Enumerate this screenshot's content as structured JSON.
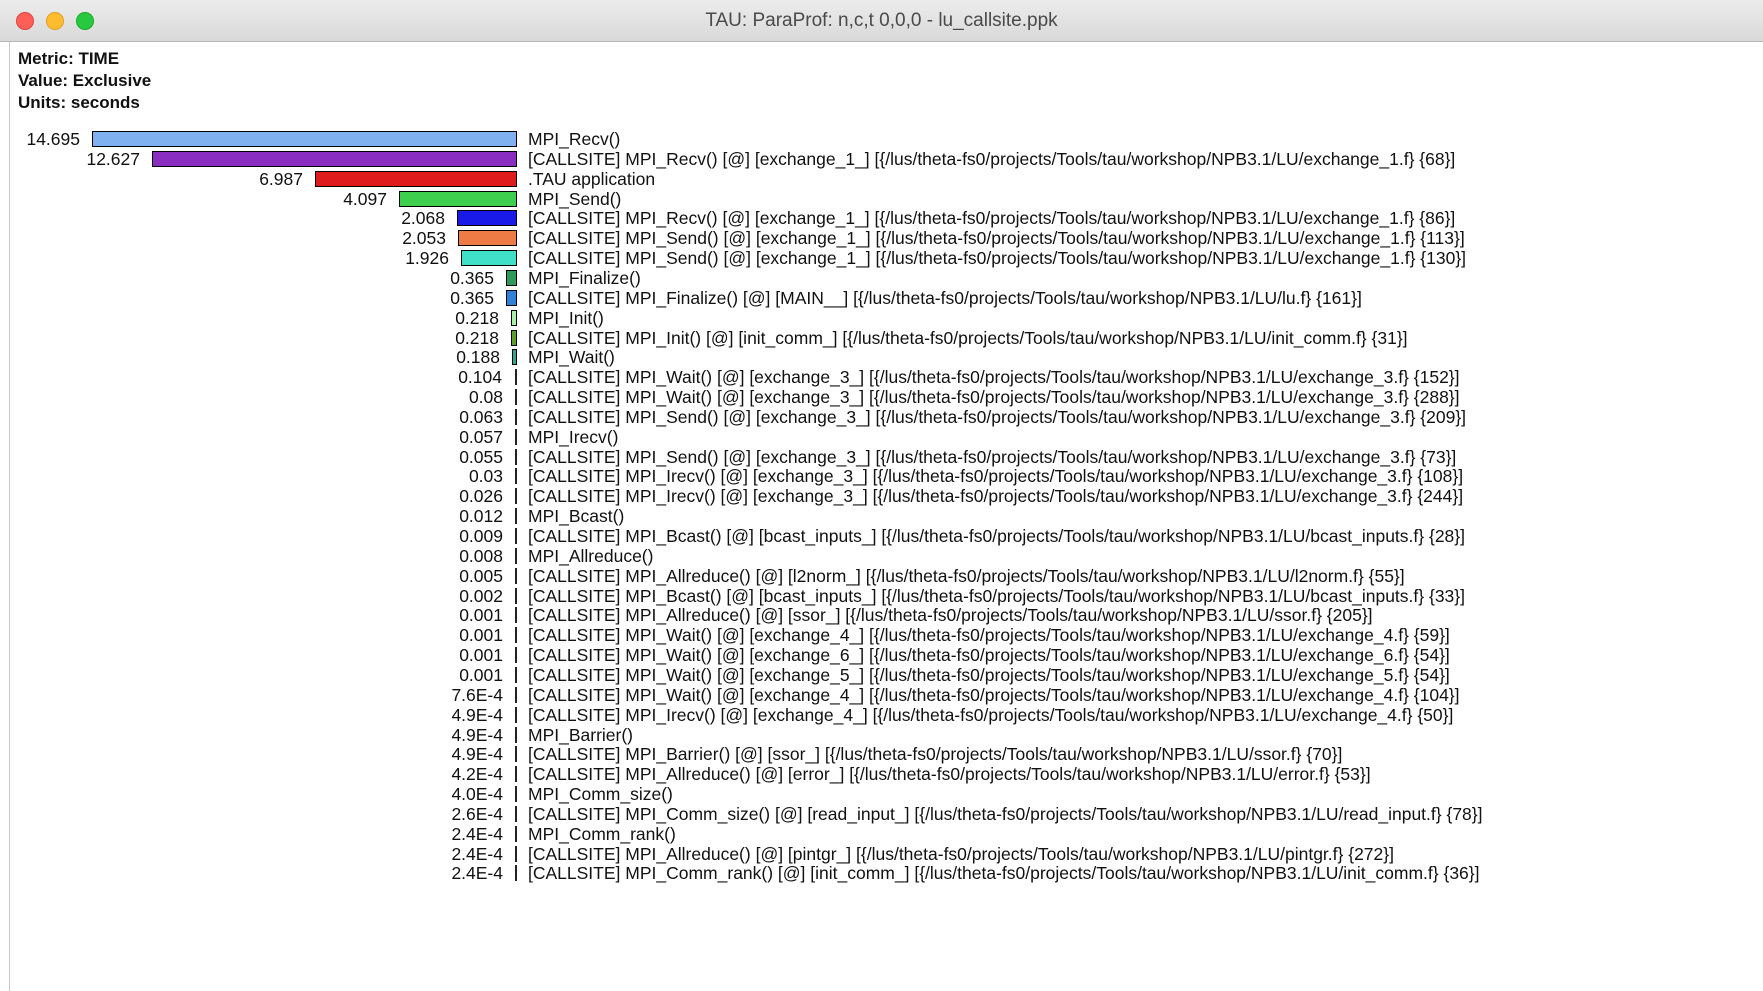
{
  "window": {
    "title": "TAU: ParaProf: n,c,t 0,0,0 - lu_callsite.ppk"
  },
  "meta": {
    "metric": "Metric: TIME",
    "value": "Value: Exclusive",
    "units": "Units: seconds"
  },
  "max_value": 14.695,
  "rows": [
    {
      "value": 14.695,
      "value_text": "14.695",
      "label": "MPI_Recv()",
      "color": "#7fb0f0"
    },
    {
      "value": 12.627,
      "value_text": "12.627",
      "label": "[CALLSITE] MPI_Recv() [@] [exchange_1_] [{/lus/theta-fs0/projects/Tools/tau/workshop/NPB3.1/LU/exchange_1.f} {68}]",
      "color": "#8a2ec2"
    },
    {
      "value": 6.987,
      "value_text": "6.987",
      "label": ".TAU application",
      "color": "#e01b1b"
    },
    {
      "value": 4.097,
      "value_text": "4.097",
      "label": "MPI_Send()",
      "color": "#3fcf4f"
    },
    {
      "value": 2.068,
      "value_text": "2.068",
      "label": "[CALLSITE] MPI_Recv() [@] [exchange_1_] [{/lus/theta-fs0/projects/Tools/tau/workshop/NPB3.1/LU/exchange_1.f} {86}]",
      "color": "#1a1ae8"
    },
    {
      "value": 2.053,
      "value_text": "2.053",
      "label": "[CALLSITE] MPI_Send() [@] [exchange_1_] [{/lus/theta-fs0/projects/Tools/tau/workshop/NPB3.1/LU/exchange_1.f} {113}]",
      "color": "#ee7a45"
    },
    {
      "value": 1.926,
      "value_text": "1.926",
      "label": "[CALLSITE] MPI_Send() [@] [exchange_1_] [{/lus/theta-fs0/projects/Tools/tau/workshop/NPB3.1/LU/exchange_1.f} {130}]",
      "color": "#40e0c8"
    },
    {
      "value": 0.365,
      "value_text": "0.365",
      "label": "MPI_Finalize()",
      "color": "#2e9a5a"
    },
    {
      "value": 0.365,
      "value_text": "0.365",
      "label": "[CALLSITE] MPI_Finalize() [@] [MAIN__] [{/lus/theta-fs0/projects/Tools/tau/workshop/NPB3.1/LU/lu.f} {161}]",
      "color": "#2f82d8"
    },
    {
      "value": 0.218,
      "value_text": "0.218",
      "label": "MPI_Init()",
      "color": "#a8f0a8"
    },
    {
      "value": 0.218,
      "value_text": "0.218",
      "label": "[CALLSITE] MPI_Init() [@] [init_comm_] [{/lus/theta-fs0/projects/Tools/tau/workshop/NPB3.1/LU/init_comm.f} {31}]",
      "color": "#5aa02a"
    },
    {
      "value": 0.188,
      "value_text": "0.188",
      "label": "MPI_Wait()",
      "color": "#2aa890"
    },
    {
      "value": 0.104,
      "value_text": "0.104",
      "label": "[CALLSITE] MPI_Wait() [@] [exchange_3_] [{/lus/theta-fs0/projects/Tools/tau/workshop/NPB3.1/LU/exchange_3.f} {152}]",
      "color": "#9ac040"
    },
    {
      "value": 0.08,
      "value_text": "0.08",
      "label": "[CALLSITE] MPI_Wait() [@] [exchange_3_] [{/lus/theta-fs0/projects/Tools/tau/workshop/NPB3.1/LU/exchange_3.f} {288}]",
      "color": "#1a3a8a"
    },
    {
      "value": 0.063,
      "value_text": "0.063",
      "label": "[CALLSITE] MPI_Send() [@] [exchange_3_] [{/lus/theta-fs0/projects/Tools/tau/workshop/NPB3.1/LU/exchange_3.f} {209}]",
      "color": "#4a4a4a"
    },
    {
      "value": 0.057,
      "value_text": "0.057",
      "label": "MPI_Irecv()",
      "color": "#3a3a3a"
    },
    {
      "value": 0.055,
      "value_text": "0.055",
      "label": "[CALLSITE] MPI_Send() [@] [exchange_3_] [{/lus/theta-fs0/projects/Tools/tau/workshop/NPB3.1/LU/exchange_3.f} {73}]",
      "color": "#1a2a6a"
    },
    {
      "value": 0.03,
      "value_text": "0.03",
      "label": "[CALLSITE] MPI_Irecv() [@] [exchange_3_] [{/lus/theta-fs0/projects/Tools/tau/workshop/NPB3.1/LU/exchange_3.f} {108}]",
      "color": "#555555"
    },
    {
      "value": 0.026,
      "value_text": "0.026",
      "label": "[CALLSITE] MPI_Irecv() [@] [exchange_3_] [{/lus/theta-fs0/projects/Tools/tau/workshop/NPB3.1/LU/exchange_3.f} {244}]",
      "color": "#555555"
    },
    {
      "value": 0.012,
      "value_text": "0.012",
      "label": "MPI_Bcast()",
      "color": "#555555"
    },
    {
      "value": 0.009,
      "value_text": "0.009",
      "label": "[CALLSITE] MPI_Bcast() [@] [bcast_inputs_] [{/lus/theta-fs0/projects/Tools/tau/workshop/NPB3.1/LU/bcast_inputs.f} {28}]",
      "color": "#555555"
    },
    {
      "value": 0.008,
      "value_text": "0.008",
      "label": "MPI_Allreduce()",
      "color": "#555555"
    },
    {
      "value": 0.005,
      "value_text": "0.005",
      "label": "[CALLSITE] MPI_Allreduce() [@] [l2norm_] [{/lus/theta-fs0/projects/Tools/tau/workshop/NPB3.1/LU/l2norm.f} {55}]",
      "color": "#555555"
    },
    {
      "value": 0.002,
      "value_text": "0.002",
      "label": "[CALLSITE] MPI_Bcast() [@] [bcast_inputs_] [{/lus/theta-fs0/projects/Tools/tau/workshop/NPB3.1/LU/bcast_inputs.f} {33}]",
      "color": "#555555"
    },
    {
      "value": 0.001,
      "value_text": "0.001",
      "label": "[CALLSITE] MPI_Allreduce() [@] [ssor_] [{/lus/theta-fs0/projects/Tools/tau/workshop/NPB3.1/LU/ssor.f} {205}]",
      "color": "#555555"
    },
    {
      "value": 0.001,
      "value_text": "0.001",
      "label": "[CALLSITE] MPI_Wait() [@] [exchange_4_] [{/lus/theta-fs0/projects/Tools/tau/workshop/NPB3.1/LU/exchange_4.f} {59}]",
      "color": "#555555"
    },
    {
      "value": 0.001,
      "value_text": "0.001",
      "label": "[CALLSITE] MPI_Wait() [@] [exchange_6_] [{/lus/theta-fs0/projects/Tools/tau/workshop/NPB3.1/LU/exchange_6.f} {54}]",
      "color": "#555555"
    },
    {
      "value": 0.001,
      "value_text": "0.001",
      "label": "[CALLSITE] MPI_Wait() [@] [exchange_5_] [{/lus/theta-fs0/projects/Tools/tau/workshop/NPB3.1/LU/exchange_5.f} {54}]",
      "color": "#555555"
    },
    {
      "value": 0.00076,
      "value_text": "7.6E-4",
      "label": "[CALLSITE] MPI_Wait() [@] [exchange_4_] [{/lus/theta-fs0/projects/Tools/tau/workshop/NPB3.1/LU/exchange_4.f} {104}]",
      "color": "#555555"
    },
    {
      "value": 0.00049,
      "value_text": "4.9E-4",
      "label": "[CALLSITE] MPI_Irecv() [@] [exchange_4_] [{/lus/theta-fs0/projects/Tools/tau/workshop/NPB3.1/LU/exchange_4.f} {50}]",
      "color": "#555555"
    },
    {
      "value": 0.00049,
      "value_text": "4.9E-4",
      "label": "MPI_Barrier()",
      "color": "#555555"
    },
    {
      "value": 0.00049,
      "value_text": "4.9E-4",
      "label": "[CALLSITE] MPI_Barrier() [@] [ssor_] [{/lus/theta-fs0/projects/Tools/tau/workshop/NPB3.1/LU/ssor.f} {70}]",
      "color": "#555555"
    },
    {
      "value": 0.00042,
      "value_text": "4.2E-4",
      "label": "[CALLSITE] MPI_Allreduce() [@] [error_] [{/lus/theta-fs0/projects/Tools/tau/workshop/NPB3.1/LU/error.f} {53}]",
      "color": "#555555"
    },
    {
      "value": 0.0004,
      "value_text": "4.0E-4",
      "label": "MPI_Comm_size()",
      "color": "#555555"
    },
    {
      "value": 0.00026,
      "value_text": "2.6E-4",
      "label": "[CALLSITE] MPI_Comm_size() [@] [read_input_] [{/lus/theta-fs0/projects/Tools/tau/workshop/NPB3.1/LU/read_input.f} {78}]",
      "color": "#555555"
    },
    {
      "value": 0.00024,
      "value_text": "2.4E-4",
      "label": "MPI_Comm_rank()",
      "color": "#555555"
    },
    {
      "value": 0.00024,
      "value_text": "2.4E-4",
      "label": "[CALLSITE] MPI_Allreduce() [@] [pintgr_] [{/lus/theta-fs0/projects/Tools/tau/workshop/NPB3.1/LU/pintgr.f} {272}]",
      "color": "#555555"
    },
    {
      "value": 0.00024,
      "value_text": "2.4E-4",
      "label": "[CALLSITE] MPI_Comm_rank() [@] [init_comm_] [{/lus/theta-fs0/projects/Tools/tau/workshop/NPB3.1/LU/init_comm.f} {36}]",
      "color": "#555555"
    }
  ]
}
